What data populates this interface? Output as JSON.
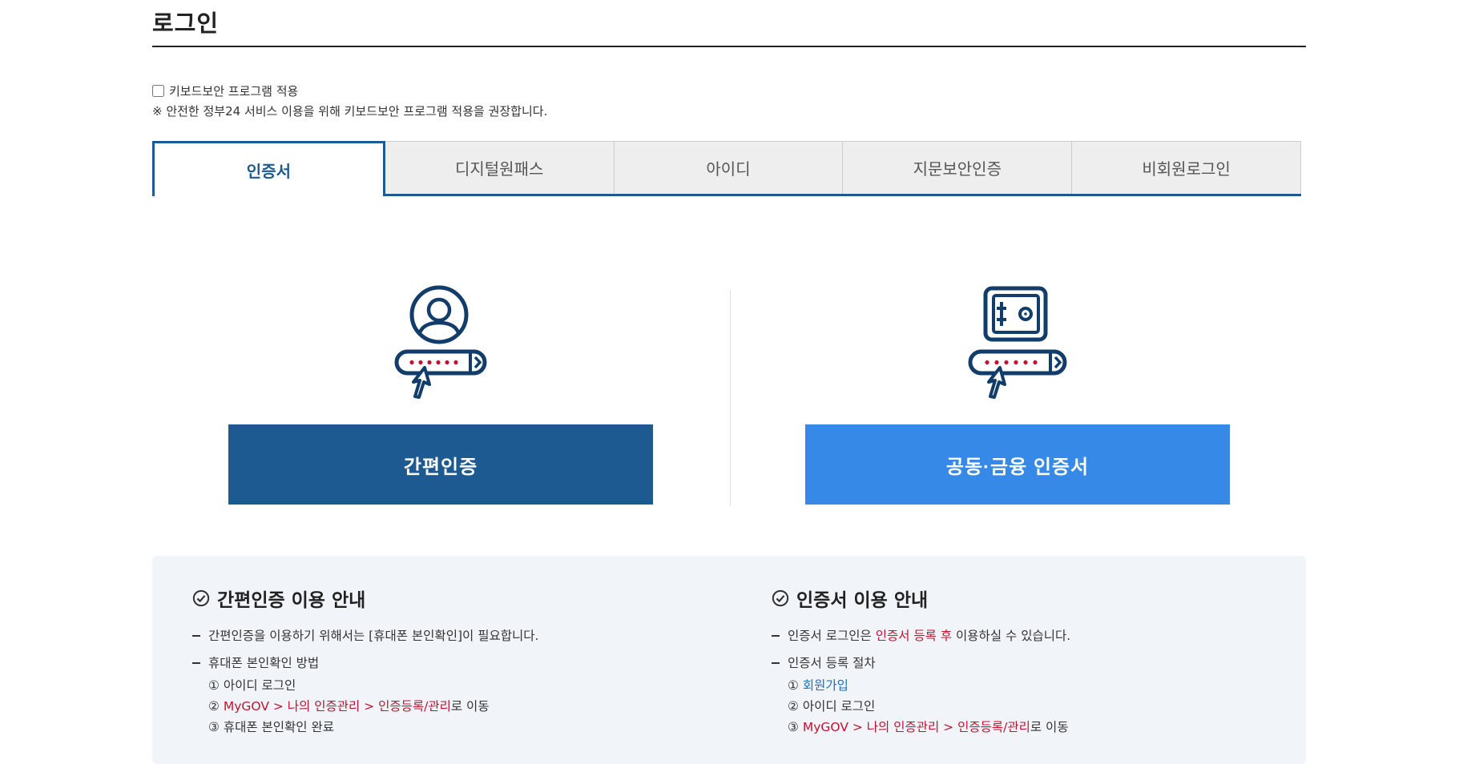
{
  "page_title": "로그인",
  "keyboard_security": {
    "checkbox_label": "키보드보안 프로그램 적용",
    "notice": "※ 안전한 정부24 서비스 이용을 위해 키보드보안 프로그램 적용을 권장합니다."
  },
  "tabs": [
    {
      "label": "인증서",
      "active": true
    },
    {
      "label": "디지털원패스",
      "active": false
    },
    {
      "label": "아이디",
      "active": false
    },
    {
      "label": "지문보안인증",
      "active": false
    },
    {
      "label": "비회원로그인",
      "active": false
    }
  ],
  "login_options": {
    "simple_auth_label": "간편인증",
    "joint_cert_label": "공동·금융 인증서"
  },
  "guide_simple": {
    "title": "간편인증 이용 안내",
    "line1": "간편인증을 이용하기 위해서는 [휴대폰 본인확인]이 필요합니다.",
    "line2": "휴대폰 본인확인 방법",
    "step1": "① 아이디 로그인",
    "step2_prefix": "② ",
    "step2_red": "MyGOV > 나의 인증관리 > 인증등록/관리",
    "step2_suffix": "로 이동",
    "step3": "③ 휴대폰 본인확인 완료"
  },
  "guide_cert": {
    "title": "인증서 이용 안내",
    "line1_prefix": "인증서 로그인은 ",
    "line1_red": "인증서 등록 후",
    "line1_suffix": " 이용하실 수 있습니다.",
    "line2": "인증서 등록 절차",
    "step1_prefix": "① ",
    "step1_blue": "회원가입",
    "step2": "② 아이디 로그인",
    "step3_prefix": "③ ",
    "step3_red": "MyGOV > 나의 인증관리 > 인증등록/관리",
    "step3_suffix": "로 이동"
  },
  "colors": {
    "primary": "#1d5a92",
    "accent_blue": "#3689e6",
    "highlight_red": "#c8102e",
    "guide_bg": "#f1f5f9"
  }
}
